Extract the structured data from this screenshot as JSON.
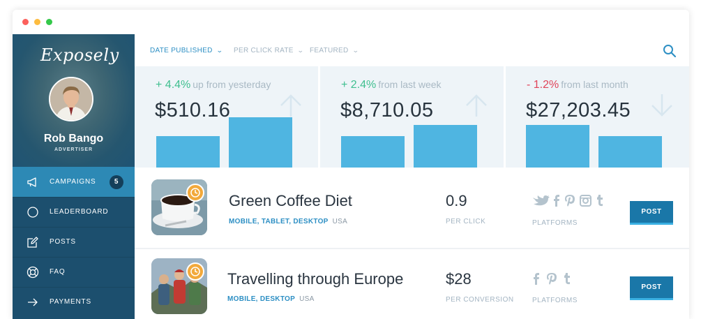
{
  "sidebar": {
    "logo": "Exposely",
    "profile": {
      "name": "Rob Bango",
      "role": "ADVERTISER"
    },
    "nav": [
      {
        "label": "CAMPAIGNS",
        "icon": "megaphone-icon",
        "badge": "5",
        "active": true
      },
      {
        "label": "LEADERBOARD",
        "icon": "circle-icon"
      },
      {
        "label": "POSTS",
        "icon": "edit-icon"
      },
      {
        "label": "FAQ",
        "icon": "lifebuoy-icon"
      },
      {
        "label": "PAYMENTS",
        "icon": "arrow-right-icon"
      }
    ]
  },
  "filters": [
    {
      "label": "DATE PUBLISHED",
      "selected": true
    },
    {
      "label": "PER CLICK RATE"
    },
    {
      "label": "FEATURED"
    }
  ],
  "stats": [
    {
      "change": "+ 4.4%",
      "period": "up from yesterday",
      "amount": "$510.16",
      "direction": "up",
      "color": "#3fbf8f",
      "bars": [
        0.5,
        0.8
      ]
    },
    {
      "change": "+ 2.4%",
      "period": "from last week",
      "amount": "$8,710.05",
      "direction": "up",
      "color": "#3fbf8f",
      "bars": [
        0.5,
        0.68
      ]
    },
    {
      "change": "- 1.2%",
      "period": "from last month",
      "amount": "$27,203.45",
      "direction": "down",
      "color": "#e0445a",
      "bars": [
        0.68,
        0.5
      ]
    }
  ],
  "campaigns": [
    {
      "title": "Green Coffee Diet",
      "devices": "MOBILE, TABLET, DESKTOP",
      "region": "USA",
      "value": "0.9",
      "value_label": "PER CLICK",
      "platforms_label": "PLATFORMS",
      "platforms": [
        "twitter",
        "facebook",
        "pinterest",
        "instagram",
        "tumblr"
      ],
      "action": "POST"
    },
    {
      "title": "Travelling through Europe",
      "devices": "MOBILE, DESKTOP",
      "region": "USA",
      "value": "$28",
      "value_label": "PER CONVERSION",
      "platforms_label": "PLATFORMS",
      "platforms": [
        "facebook",
        "pinterest",
        "tumblr"
      ],
      "action": "POST"
    }
  ],
  "colors": {
    "accent": "#2d8fc4",
    "sidebar": "#1c4f6e",
    "active_nav": "#2d89b5",
    "bar": "#4fb5e1",
    "stat_bg": "#eef4f8",
    "post_button": "#1a77a8"
  }
}
